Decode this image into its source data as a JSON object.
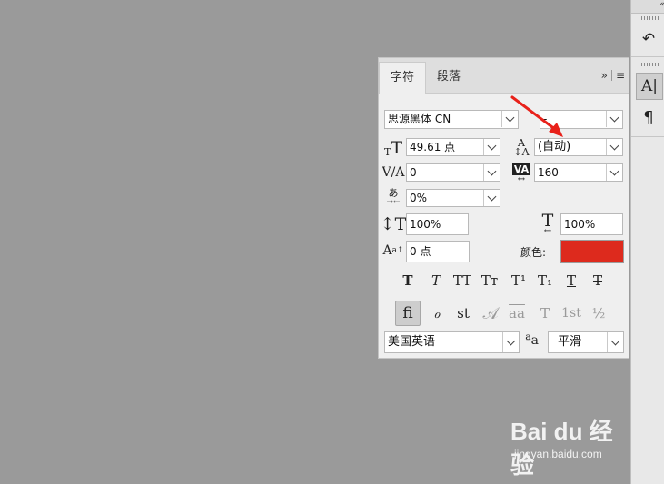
{
  "panel": {
    "tabs": [
      {
        "label": "字符"
      },
      {
        "label": "段落"
      }
    ],
    "tools": {
      "expand": "»",
      "menu": "≡"
    },
    "font_family": "思源黑体 CN",
    "font_style": "-",
    "font_size": "49.61 点",
    "leading": "(自动)",
    "kerning": "0",
    "tracking": "160",
    "tsume": "0%",
    "vertical_scale": "100%",
    "horizontal_scale": "100%",
    "baseline_shift": "0 点",
    "color_label": "颜色:",
    "color_value": "#dd2a1d",
    "language": "美国英语",
    "antialias_icon": "ªa",
    "antialias": "平滑",
    "style_buttons": [
      "T",
      "T",
      "TT",
      "Tт",
      "T¹",
      "T₁",
      "T",
      "T"
    ],
    "opentype_buttons": [
      "ﬁ",
      "ℴ",
      "st",
      "𝒜",
      "aa",
      "T",
      "1st",
      "½"
    ]
  },
  "dock": {
    "collapse_icon": "«",
    "history_icon": "↶",
    "character_icon": "A|",
    "paragraph_icon": "¶"
  },
  "watermark": {
    "logo": "Bai du 经验",
    "url": "jingyan.baidu.com"
  },
  "colors": {
    "canvas": "#9a9a9a",
    "annotation_arrow": "#e8211a"
  }
}
